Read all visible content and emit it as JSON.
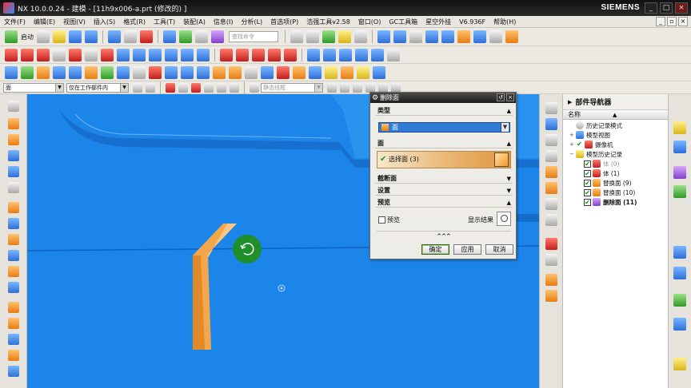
{
  "window": {
    "title": "NX 10.0.0.24 - 建模 - [11h9x006-a.prt  (修改的)  ]",
    "brand": "SIEMENS"
  },
  "menus": [
    "文件(F)",
    "编辑(E)",
    "视图(V)",
    "插入(S)",
    "格式(R)",
    "工具(T)",
    "装配(A)",
    "信息(I)",
    "分析(L)",
    "首选项(P)",
    "浩强工具v2.58",
    "窗口(O)",
    "GC工具箱",
    "星空外挂",
    "V6.936F",
    "帮助(H)"
  ],
  "toolbar": {
    "start_label": "启动",
    "search_placeholder": "查找命令"
  },
  "filter": {
    "type_value": "面",
    "scope_value": "仅在工作部件内",
    "snap_value": "静态线框"
  },
  "dialog": {
    "title": "删除面",
    "section_type": "类型",
    "type_value": "面",
    "section_face": "面",
    "select_face_label": "选择面 (3)",
    "section_cut": "截断面",
    "section_settings": "设置",
    "section_preview": "预览",
    "preview_label": "预览",
    "show_result_label": "显示结果",
    "collapse": "^^^",
    "ok": "确定",
    "apply": "应用",
    "cancel": "取消"
  },
  "navigator": {
    "title": "部件导航器",
    "col_name": "名称",
    "items": [
      {
        "label": "历史记录模式",
        "muted": false,
        "bold": false
      },
      {
        "label": "模型视图",
        "muted": false,
        "bold": false
      },
      {
        "label": "摄像机",
        "muted": false,
        "bold": false
      },
      {
        "label": "模型历史记录",
        "muted": false,
        "bold": false
      },
      {
        "label": "体 (0)",
        "muted": true,
        "bold": false
      },
      {
        "label": "体 (1)",
        "muted": false,
        "bold": false
      },
      {
        "label": "替换面 (9)",
        "muted": false,
        "bold": false
      },
      {
        "label": "替换面 (10)",
        "muted": false,
        "bold": false
      },
      {
        "label": "删除面 (11)",
        "muted": false,
        "bold": true
      }
    ]
  },
  "colors": {
    "viewport": "#1c85ea",
    "face_highlight": "#f4a64a",
    "marker": "#1f8f2a"
  }
}
